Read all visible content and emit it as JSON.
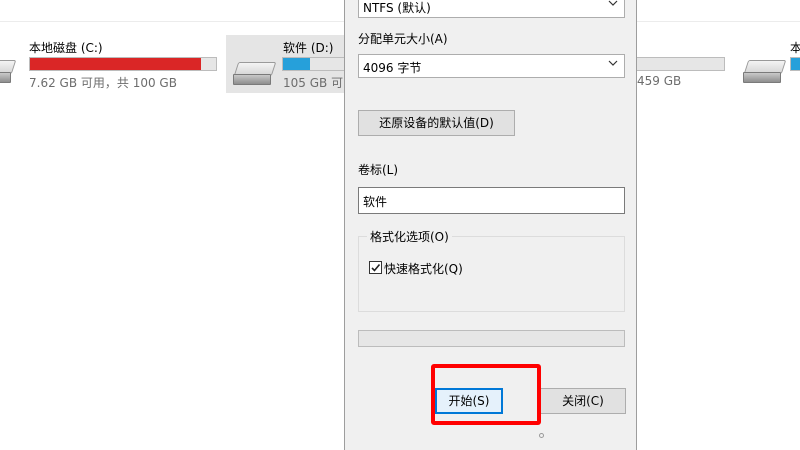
{
  "drives": [
    {
      "name": "本地磁盘 (C:)",
      "usage": "7.62 GB 可用，共 100 GB",
      "used_fraction": 0.92,
      "bar_color": "#da2626",
      "selected": false
    },
    {
      "name": "软件 (D:)",
      "usage": "105 GB 可",
      "used_fraction": 0.4,
      "bar_color": "#26a0da",
      "selected": true
    },
    {
      "name": "",
      "usage": "459 GB",
      "used_fraction": 0.0,
      "bar_color": "#26a0da",
      "selected": false
    },
    {
      "name": "本",
      "usage": "",
      "used_fraction": 0.3,
      "bar_color": "#26a0da",
      "selected": false
    }
  ],
  "dialog": {
    "file_system": {
      "value": "NTFS (默认)"
    },
    "allocation": {
      "label": "分配单元大小(A)",
      "value": "4096 字节"
    },
    "restore_button": "还原设备的默认值(D)",
    "volume": {
      "label": "卷标(L)",
      "value": "软件"
    },
    "options": {
      "title": "格式化选项(O)",
      "quick_format": "快速格式化(Q)",
      "quick_format_checked": true
    },
    "progress": 0,
    "start_button": "开始(S)",
    "close_button": "关闭(C)"
  },
  "colors": {
    "accent": "#0078d7",
    "highlight": "#ff0000"
  }
}
